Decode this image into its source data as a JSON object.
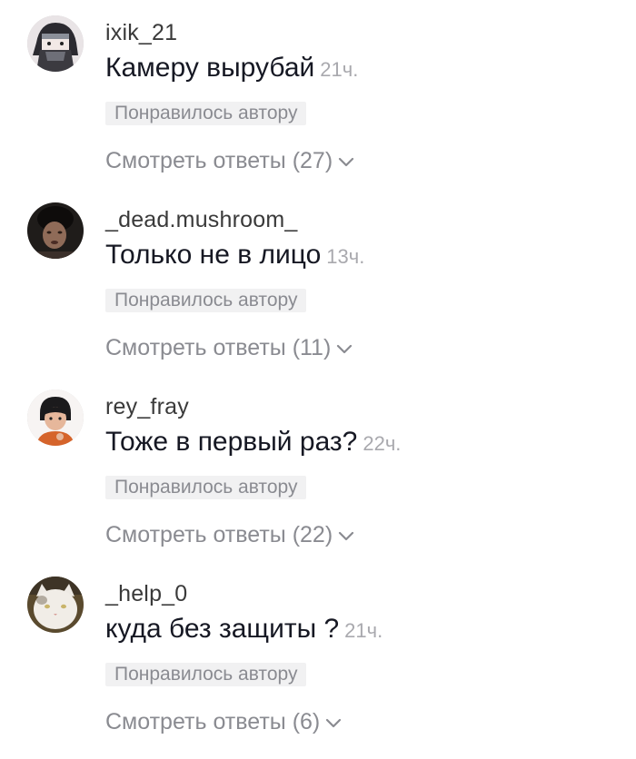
{
  "comments": [
    {
      "username": "ixik_21",
      "text": "Камеру вырубай",
      "time": "21ч.",
      "liked_label": "Понравилось автору",
      "replies_label": "Смотреть ответы (27)",
      "avatar_icon": "anime-masked-avatar"
    },
    {
      "username": "_dead.mushroom_",
      "text": "Только не в лицо",
      "time": "13ч.",
      "liked_label": "Понравилось автору",
      "replies_label": "Смотреть ответы (11)",
      "avatar_icon": "dark-photo-avatar"
    },
    {
      "username": "rey_fray",
      "text": "Тоже в первый раз?",
      "time": "22ч.",
      "liked_label": "Понравилось автору",
      "replies_label": "Смотреть ответы (22)",
      "avatar_icon": "cartoon-character-avatar"
    },
    {
      "username": "_help_0",
      "text": "куда без защиты ?",
      "time": "21ч.",
      "liked_label": "Понравилось автору",
      "replies_label": "Смотреть ответы (6)",
      "avatar_icon": "cat-photo-avatar"
    }
  ],
  "colors": {
    "text_primary": "#161823",
    "text_secondary": "#8a8b91",
    "badge_background": "#f1f1f2"
  }
}
